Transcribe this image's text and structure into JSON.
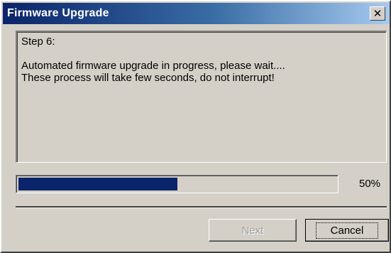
{
  "window": {
    "title": "Firmware Upgrade",
    "close_glyph": "✕",
    "close_icon": "close-icon"
  },
  "message": {
    "step": "Step 6:",
    "line1": "Automated firmware upgrade in progress, please wait....",
    "line2": "These process will take few seconds, do not interrupt!"
  },
  "progress": {
    "value": 0.5,
    "text": "50%",
    "fill_color": "#0a246a"
  },
  "buttons": {
    "next_label": "Next",
    "next_enabled": false,
    "cancel_label": "Cancel"
  },
  "colors": {
    "titlebar_start": "#0a246a",
    "titlebar_end": "#a6caf0",
    "face": "#d4d0c8"
  }
}
